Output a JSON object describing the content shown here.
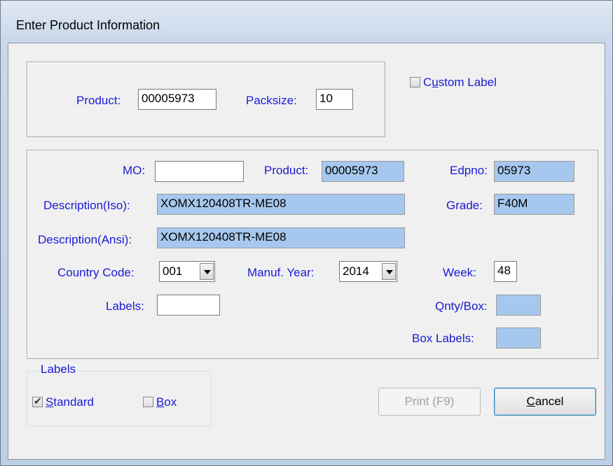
{
  "window": {
    "title": "Enter Product Information"
  },
  "top": {
    "product_label": "Product:",
    "product_value": "00005973",
    "packsize_label": "Packsize:",
    "packsize_value": "10",
    "custom_label": {
      "pre": "C",
      "accel": "u",
      "post": "stom Label",
      "checked": false
    }
  },
  "details": {
    "mo_label": "MO:",
    "mo_value": "",
    "product_label": "Product:",
    "product_value": "00005973",
    "edpno_label": "Edpno:",
    "edpno_value": "05973",
    "desc_iso_label": "Description(Iso):",
    "desc_iso_value": "XOMX120408TR-ME08",
    "grade_label": "Grade:",
    "grade_value": "F40M",
    "desc_ansi_label": "Description(Ansi):",
    "desc_ansi_value": "XOMX120408TR-ME08",
    "country_label": "Country Code:",
    "country_value": "001",
    "year_label": "Manuf. Year:",
    "year_value": "2014",
    "week_label": "Week:",
    "week_value": "48",
    "labels_label": "Labels:",
    "labels_value": "",
    "qnty_label": "Qnty/Box:",
    "qnty_value": "",
    "boxlabels_label": "Box Labels:",
    "boxlabels_value": ""
  },
  "labels_group": {
    "title": "Labels",
    "standard": {
      "pre": "",
      "accel": "S",
      "post": "tandard",
      "checked": true
    },
    "box": {
      "pre": "",
      "accel": "B",
      "post": "ox",
      "checked": false
    }
  },
  "buttons": {
    "print_label": "Print (F9)",
    "cancel": {
      "accel": "C",
      "post": "ancel"
    }
  },
  "colors": {
    "label_text": "#1a1ad6",
    "readonly_field": "#a6c8ee"
  }
}
